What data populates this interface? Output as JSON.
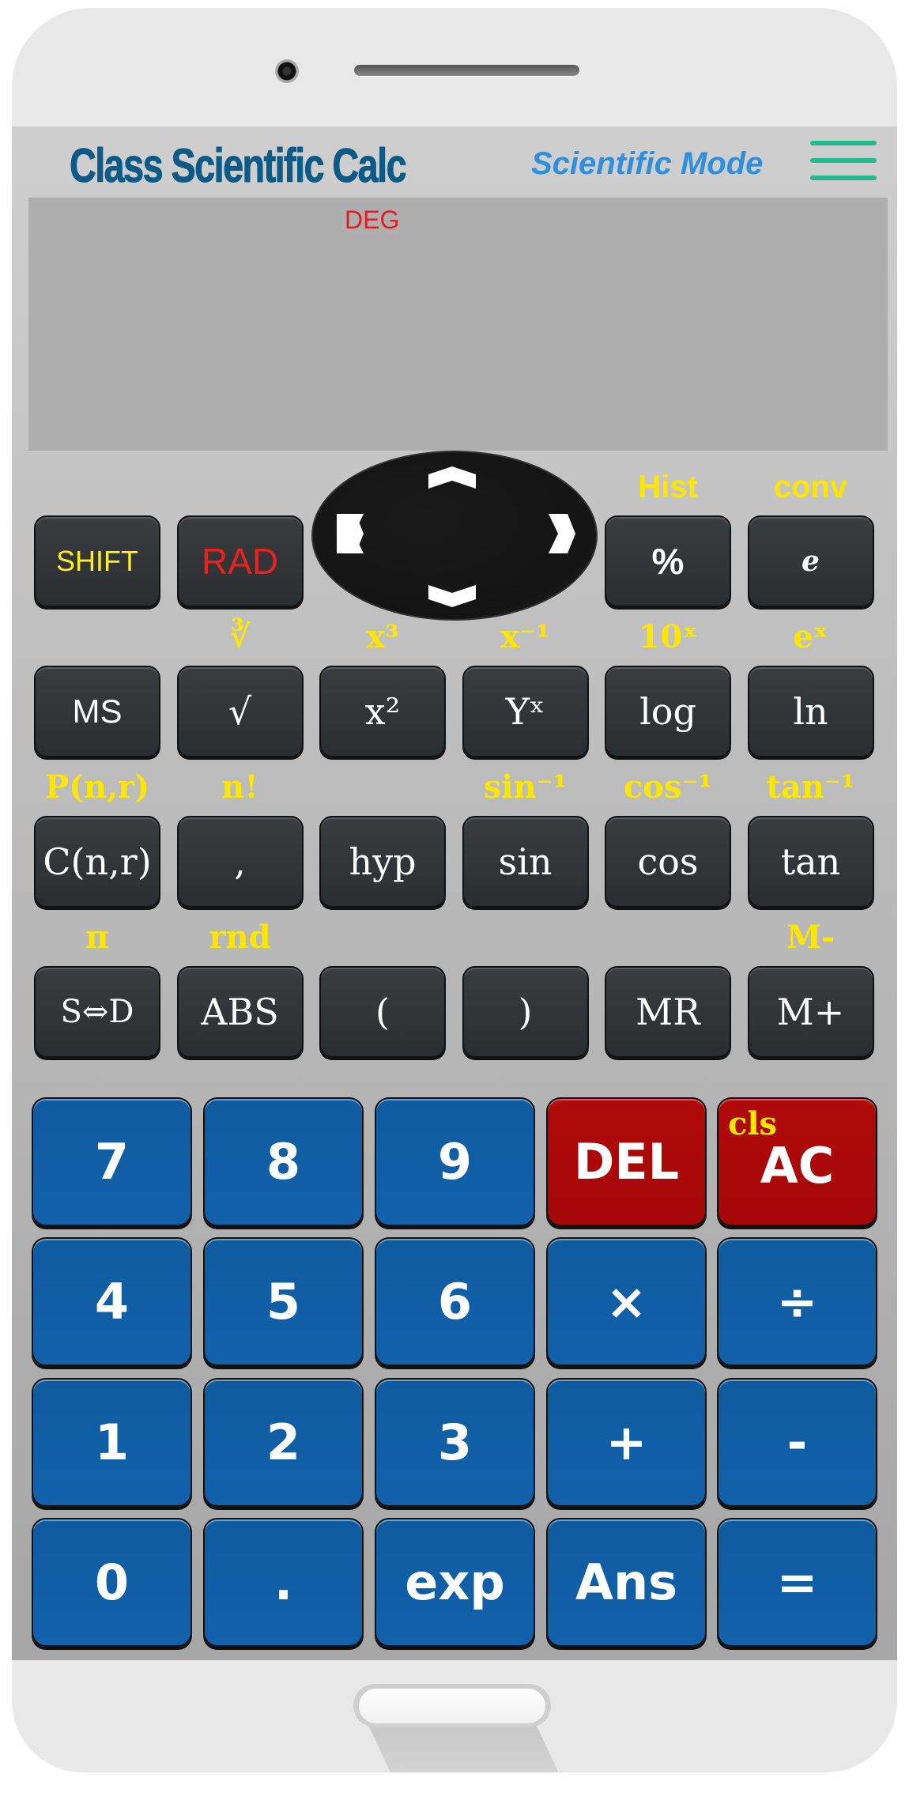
{
  "header": {
    "title": "Class Scientific Calc",
    "mode": "Scientific Mode",
    "menu_icon": "hamburger-menu-icon",
    "menu_color": "#22bb8e"
  },
  "display": {
    "angle_mode": "DEG",
    "expression": "",
    "result": ""
  },
  "dpad": {
    "up": "arrow-up-icon",
    "down": "arrow-down-icon",
    "left": "arrow-left-icon",
    "right": "arrow-right-icon"
  },
  "function_rows": [
    {
      "secondary": [
        "",
        "",
        "",
        "",
        "Hist",
        "conv"
      ],
      "keys": [
        "SHIFT",
        "RAD",
        "",
        "",
        "%",
        "e"
      ]
    },
    {
      "secondary": [
        "",
        "∛",
        "x³",
        "x⁻¹",
        "10ˣ",
        "eˣ"
      ],
      "keys": [
        "MS",
        "√",
        "x²",
        "Yˣ",
        "log",
        "ln"
      ]
    },
    {
      "secondary": [
        "P(n,r)",
        "n!",
        "",
        "sin⁻¹",
        "cos⁻¹",
        "tan⁻¹"
      ],
      "keys": [
        "C(n,r)",
        ",",
        "hyp",
        "sin",
        "cos",
        "tan"
      ]
    },
    {
      "secondary": [
        "π",
        "rnd",
        "",
        "",
        "",
        "M-"
      ],
      "keys": [
        "S⇔D",
        "ABS",
        "(",
        ")",
        "MR",
        "M+"
      ]
    }
  ],
  "keypad_rows": [
    [
      "7",
      "8",
      "9",
      "DEL",
      "AC"
    ],
    [
      "4",
      "5",
      "6",
      "×",
      "÷"
    ],
    [
      "1",
      "2",
      "3",
      "+",
      "-"
    ],
    [
      "0",
      ".",
      "exp",
      "Ans",
      "="
    ]
  ],
  "ac_secondary": "cls",
  "colors": {
    "title": "#0d5a86",
    "mode": "#2e8fdc",
    "secondary_label": "#ffe600",
    "shift_label": "#ffee22",
    "rad_label": "#e82222",
    "deg_label": "#e02020",
    "number_key": "#1261aa",
    "clear_key": "#b00a0a",
    "function_key": "#2f3235"
  }
}
